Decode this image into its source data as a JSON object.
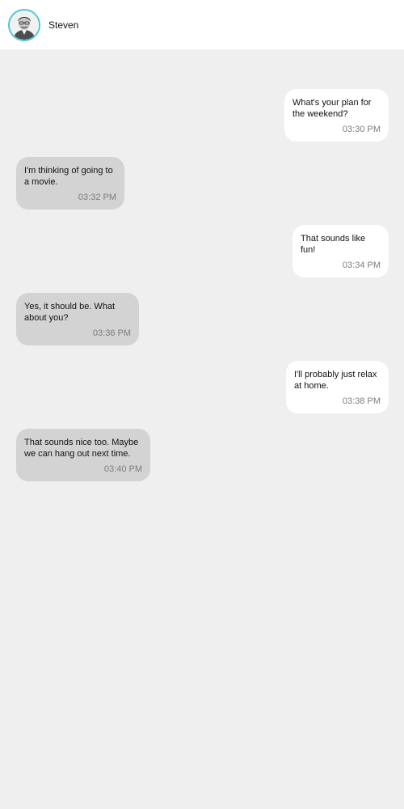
{
  "header": {
    "contact_name": "Steven"
  },
  "messages": [
    {
      "direction": "sent",
      "text": "What's your plan for the weekend?",
      "time": "03:30 PM"
    },
    {
      "direction": "received",
      "text": "I'm thinking of going to a movie.",
      "time": "03:32 PM"
    },
    {
      "direction": "sent",
      "text": "That sounds like fun!",
      "time": "03:34 PM"
    },
    {
      "direction": "received",
      "text": "Yes, it should be. What about you?",
      "time": "03:36 PM"
    },
    {
      "direction": "sent",
      "text": "I'll probably just relax at home.",
      "time": "03:38 PM"
    },
    {
      "direction": "received",
      "text": "That sounds nice too. Maybe we can hang out next time.",
      "time": "03:40 PM"
    }
  ],
  "colors": {
    "background": "#efefef",
    "header": "#ffffff",
    "sent_bubble": "#ffffff",
    "received_bubble": "#d3d3d3",
    "avatar_ring": "#4fc6d3",
    "timestamp": "#7d7d7d"
  }
}
